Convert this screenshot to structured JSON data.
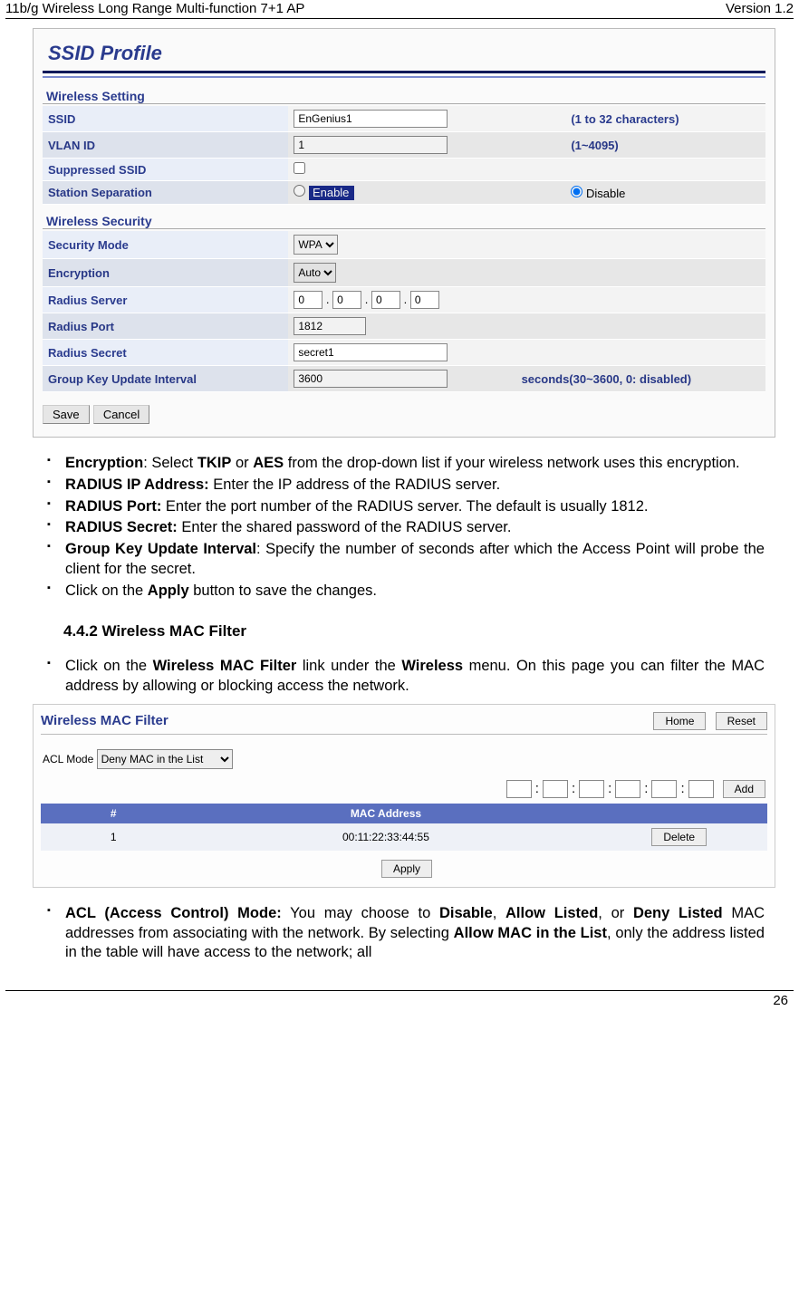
{
  "header": {
    "left": "11b/g Wireless Long Range Multi-function 7+1 AP",
    "right": "Version 1.2"
  },
  "panel": {
    "title": "SSID Profile",
    "wireless_setting_head": "Wireless Setting",
    "wireless_security_head": "Wireless Security",
    "ssid_label": "SSID",
    "ssid_value": "EnGenius1",
    "ssid_hint": "(1 to 32 characters)",
    "vlan_label": "VLAN ID",
    "vlan_value": "1",
    "vlan_hint": "(1~4095)",
    "supp_label": "Suppressed SSID",
    "sep_label": "Station Separation",
    "sep_enable": "Enable",
    "sep_disable": "Disable",
    "secmode_label": "Security Mode",
    "secmode_value": "WPA",
    "enc_label": "Encryption",
    "enc_value": "Auto",
    "rserver_label": "Radius Server",
    "rserver": [
      "0",
      "0",
      "0",
      "0"
    ],
    "rport_label": "Radius Port",
    "rport_value": "1812",
    "rsecret_label": "Radius Secret",
    "rsecret_value": "secret1",
    "gku_label": "Group Key Update Interval",
    "gku_value": "3600",
    "gku_hint": "seconds(30~3600, 0: disabled)",
    "save": "Save",
    "cancel": "Cancel"
  },
  "bullets1": {
    "b0a": "Encryption",
    "b0b": ": Select ",
    "b0c": "TKIP",
    "b0d": " or ",
    "b0e": "AES",
    "b0f": " from the drop-down list if your wireless network uses this encryption.",
    "b1a": "RADIUS IP Address:",
    "b1b": " Enter the IP address of the RADIUS server.",
    "b2a": "RADIUS Port:",
    "b2b": " Enter the port number of the RADIUS server. The default is usually 1812.",
    "b3a": "RADIUS Secret:",
    "b3b": " Enter the shared password of the RADIUS server.",
    "b4a": "Group Key Update Interval",
    "b4b": ": Specify the number of seconds after which the Access Point will probe the client for the secret.",
    "b5a": "Click on the ",
    "b5b": "Apply",
    "b5c": " button to save the changes."
  },
  "section_head": "4.4.2   Wireless MAC Filter",
  "intro2": {
    "a": "Click on the ",
    "b": "Wireless MAC Filter",
    "c": " link under the ",
    "d": "Wireless",
    "e": " menu. On this page you can filter the MAC address by allowing or blocking access the network."
  },
  "mac": {
    "title": "Wireless MAC Filter",
    "home": "Home",
    "reset": "Reset",
    "acl_label": "ACL Mode",
    "acl_value": "Deny MAC in the List",
    "add": "Add",
    "col_num": "#",
    "col_mac": "MAC Address",
    "row_num": "1",
    "row_mac": "00:11:22:33:44:55",
    "delete": "Delete",
    "apply": "Apply"
  },
  "bullets2": {
    "a": "ACL (Access Control) Mode:",
    "b": " You may choose to ",
    "c": "Disable",
    "d": ", ",
    "e": "Allow Listed",
    "f": ", or ",
    "g": "Deny Listed",
    "h": " MAC addresses from associating with the network. By selecting ",
    "i": "Allow MAC in the List",
    "j": ", only the address listed in the table will have access to the network; all"
  },
  "footer": {
    "page": "26"
  }
}
